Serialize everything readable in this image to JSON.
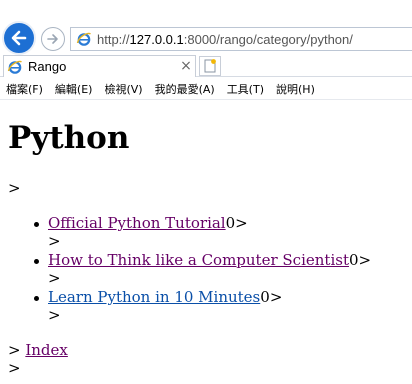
{
  "browser": {
    "url_prefix": "http://",
    "url_host": "127.0.0.1",
    "url_rest": ":8000/rango/category/python/",
    "tab_title": "Rango",
    "tab_close": "×",
    "menu": [
      "檔案(F)",
      "編輯(E)",
      "檢視(V)",
      "我的最愛(A)",
      "工具(T)",
      "說明(H)"
    ]
  },
  "page": {
    "title": "Python",
    "separator": ">",
    "pages": [
      {
        "link_text": "Official Python Tutorial",
        "views": "0",
        "suffix": ">",
        "sub": ">",
        "visited": true
      },
      {
        "link_text": "How to Think like a Computer Scientist",
        "views": "0",
        "suffix": ">",
        "sub": ">",
        "visited": true
      },
      {
        "link_text": "Learn Python in 10 Minutes",
        "views": "0",
        "suffix": ">",
        "sub": ">",
        "visited": false
      }
    ],
    "index_prefix": "> ",
    "index_link": "Index",
    "tail": ">"
  },
  "colors": {
    "visited_link": "#660066",
    "link": "#0a4fa8",
    "back_button": "#1d6fd3"
  },
  "icons": {
    "back": "back-arrow-icon",
    "forward": "forward-arrow-icon",
    "site": "ie-icon",
    "new_tab": "new-tab-icon"
  }
}
